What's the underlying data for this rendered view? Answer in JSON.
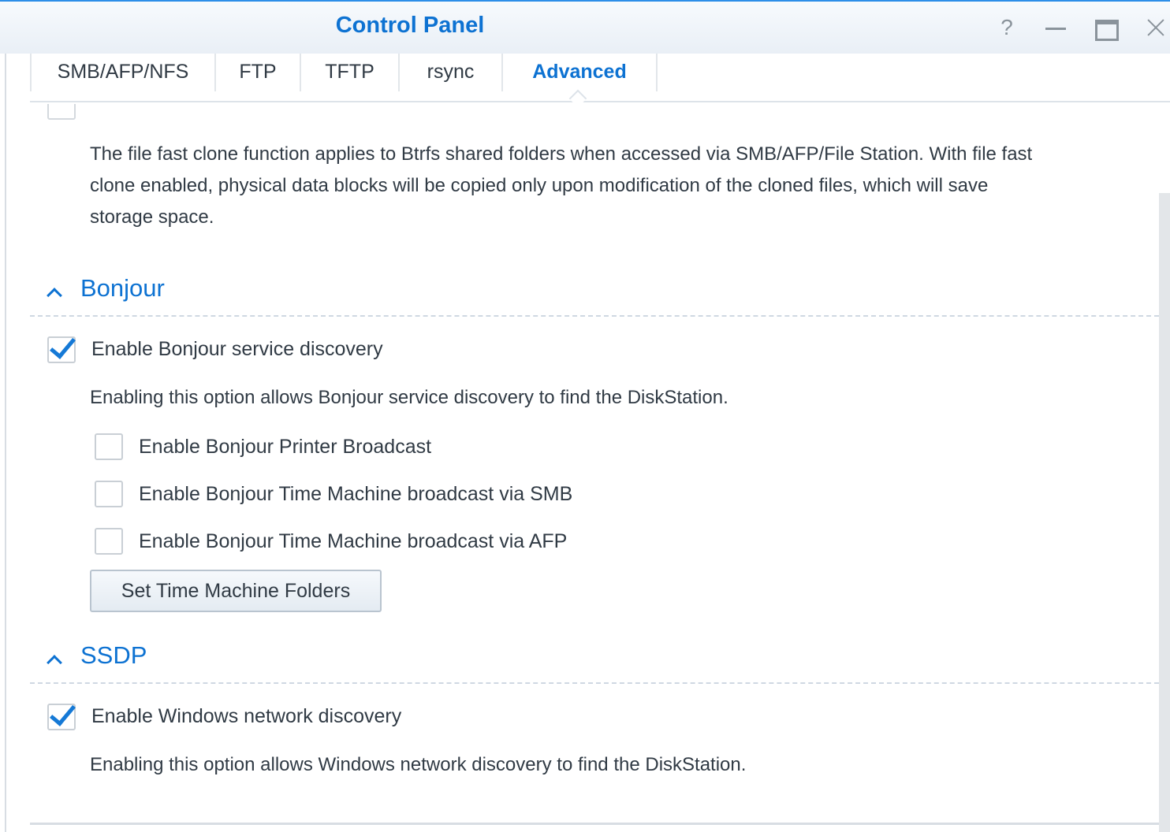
{
  "window": {
    "title": "Control Panel",
    "help_glyph": "?"
  },
  "tabs": [
    {
      "label": "SMB/AFP/NFS"
    },
    {
      "label": "FTP"
    },
    {
      "label": "TFTP"
    },
    {
      "label": "rsync"
    },
    {
      "label": "Advanced",
      "active": true
    }
  ],
  "fast_clone": {
    "description_lines": [
      "The file fast clone function applies to Btrfs shared folders when accessed via SMB/AFP/File Station. With file fast",
      "clone enabled, physical data blocks will be copied only upon modification of the cloned files, which will save",
      "storage space."
    ]
  },
  "bonjour": {
    "title": "Bonjour",
    "enable": {
      "label": "Enable Bonjour service discovery",
      "checked": true
    },
    "description": "Enabling this option allows Bonjour service discovery to find the DiskStation.",
    "options": [
      {
        "label": "Enable Bonjour Printer Broadcast",
        "checked": false
      },
      {
        "label": "Enable Bonjour Time Machine broadcast via SMB",
        "checked": false
      },
      {
        "label": "Enable Bonjour Time Machine broadcast via AFP",
        "checked": false
      }
    ],
    "button_label": "Set Time Machine Folders"
  },
  "ssdp": {
    "title": "SSDP",
    "enable": {
      "label": "Enable Windows network discovery",
      "checked": true
    },
    "description": "Enabling this option allows Windows network discovery to find the DiskStation."
  },
  "colors": {
    "accent": "#0d72d2",
    "text": "#303a44",
    "title_bar_border": "#2d8ee8"
  }
}
